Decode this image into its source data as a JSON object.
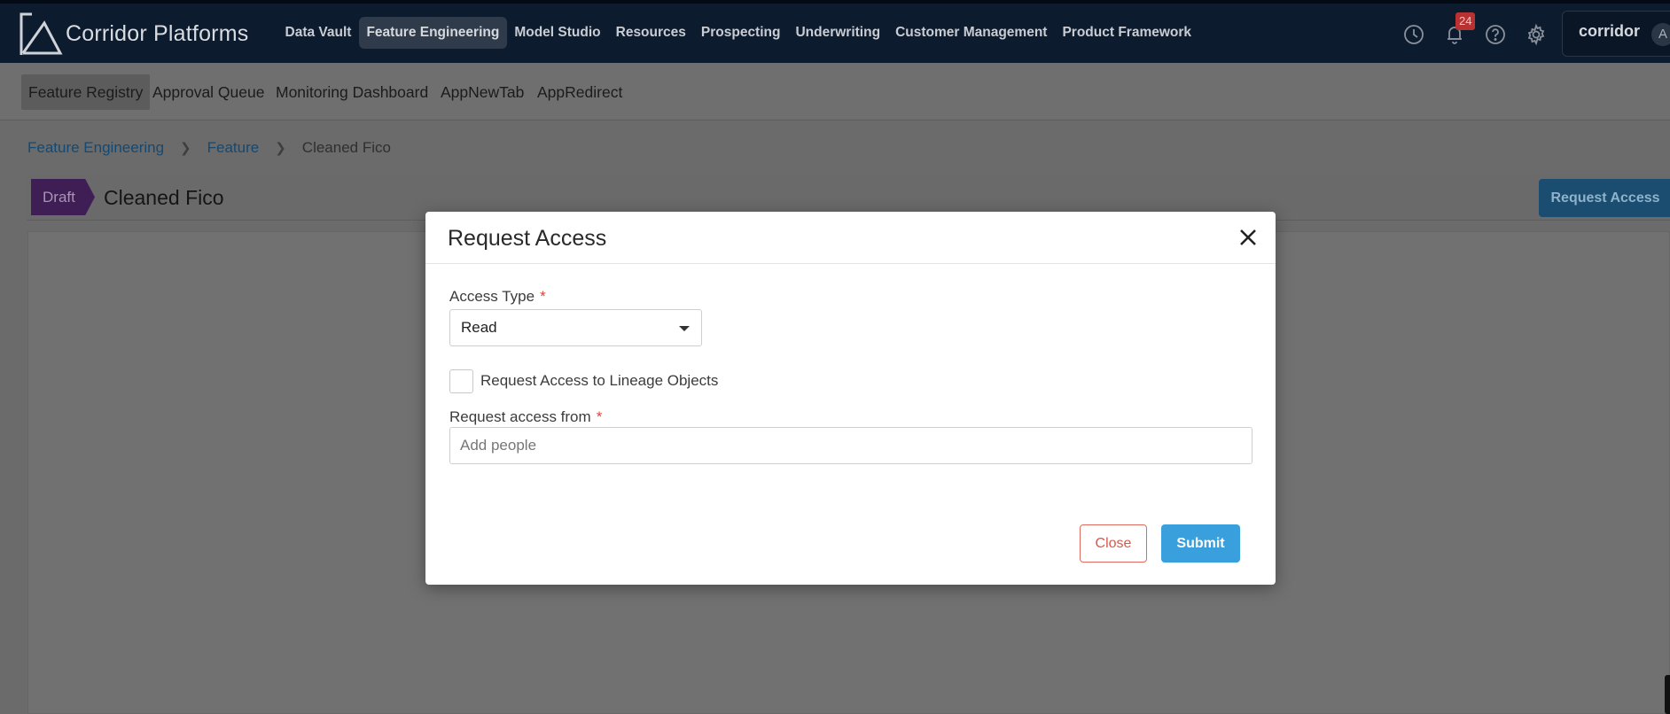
{
  "app": {
    "logo_text": "Corridor Platforms"
  },
  "main_nav": [
    {
      "label": "Data Vault",
      "active": false
    },
    {
      "label": "Feature Engineering",
      "active": true
    },
    {
      "label": "Model Studio",
      "active": false
    },
    {
      "label": "Resources",
      "active": false
    },
    {
      "label": "Prospecting",
      "active": false
    },
    {
      "label": "Underwriting",
      "active": false
    },
    {
      "label": "Customer Management",
      "active": false
    },
    {
      "label": "Product Framework",
      "active": false
    }
  ],
  "top_icons": {
    "history": "clock-icon",
    "notifications": "bell-icon",
    "notification_count": "24",
    "help": "help-icon",
    "settings": "gear-icon"
  },
  "user": {
    "name": "corridor",
    "avatar_initial": "A"
  },
  "sub_nav": [
    {
      "label": "Feature Registry",
      "active": true
    },
    {
      "label": "Approval Queue",
      "active": false
    },
    {
      "label": "Monitoring Dashboard",
      "active": false
    },
    {
      "label": "AppNewTab",
      "active": false
    },
    {
      "label": "AppRedirect",
      "active": false
    }
  ],
  "breadcrumb": {
    "items": [
      "Feature Engineering",
      "Feature"
    ],
    "current": "Cleaned Fico"
  },
  "page_header": {
    "status": "Draft",
    "title": "Cleaned Fico",
    "request_button": "Request Access"
  },
  "modal": {
    "title": "Request Access",
    "access_type_label": "Access Type",
    "access_type_value": "Read",
    "lineage_checkbox_label": "Request Access to Lineage Objects",
    "lineage_checked": false,
    "request_from_label": "Request access from",
    "request_from_placeholder": "Add people",
    "required_mark": "*",
    "close_button": "Close",
    "submit_button": "Submit"
  },
  "colors": {
    "topbar": "#0d1b2e",
    "draft_tag": "#3f1e55",
    "submit": "#3aa0dd",
    "close_outline": "#dd6a5f",
    "required": "#e0433a",
    "link": "#124a75"
  }
}
